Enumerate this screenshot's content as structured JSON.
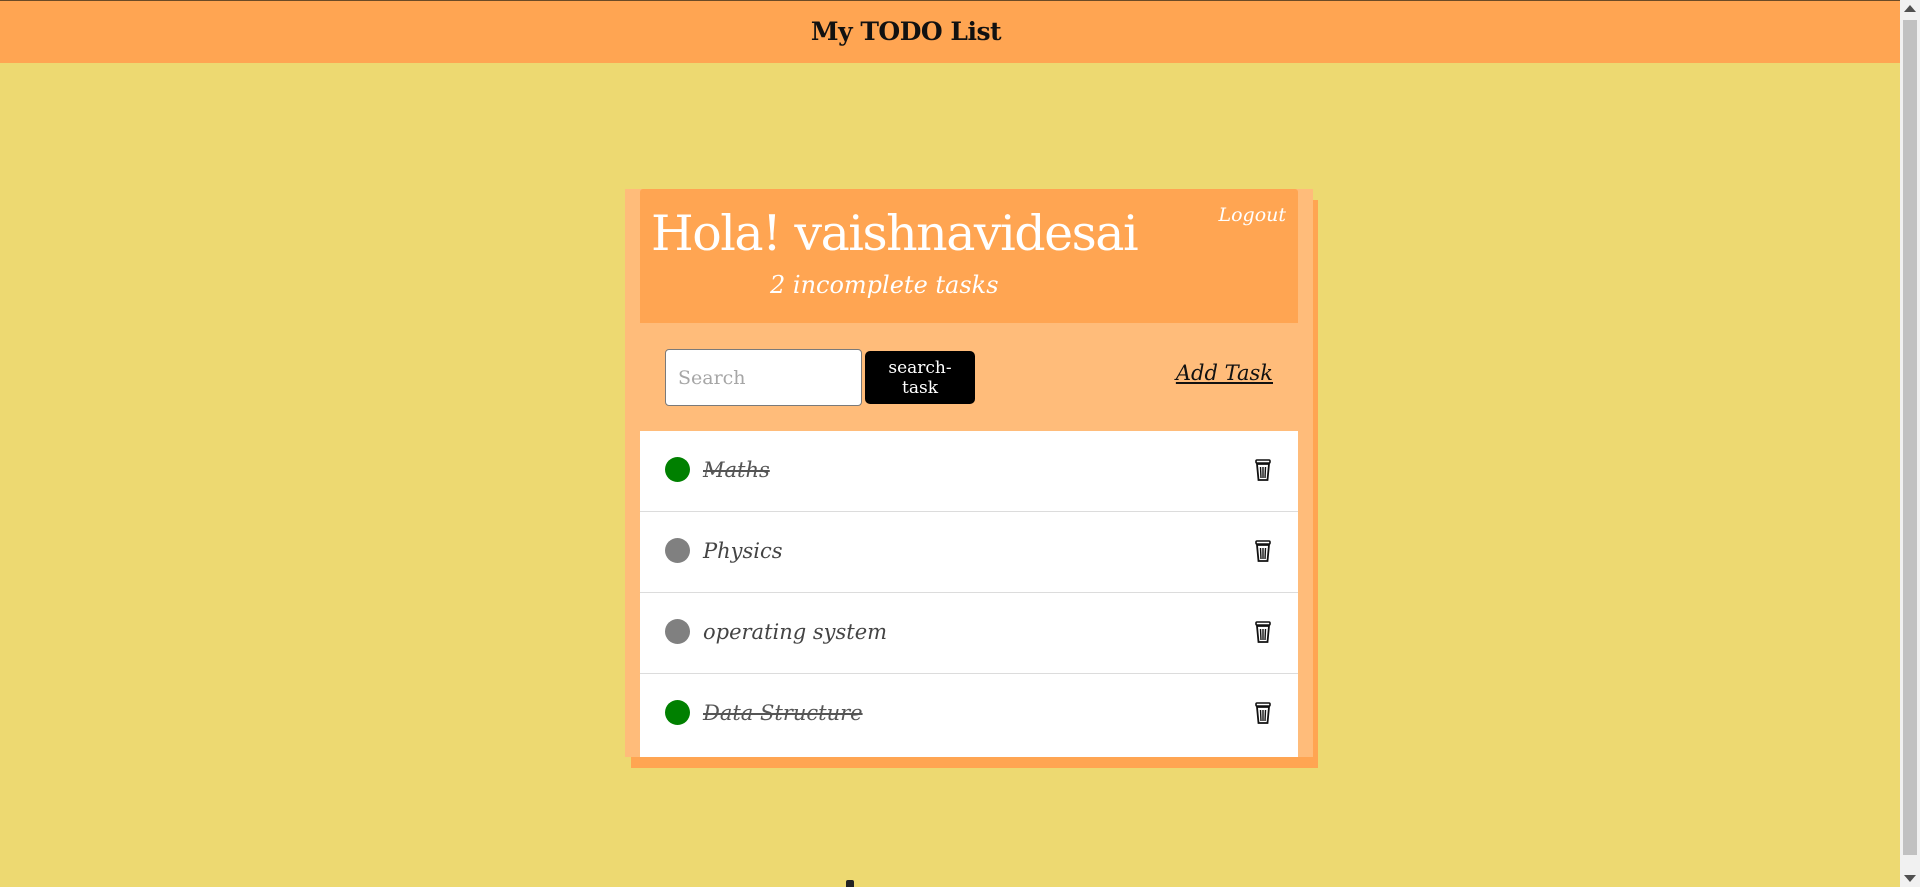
{
  "app": {
    "title": "My TODO List"
  },
  "header": {
    "greeting": "Hola! vaishnavidesai",
    "task_count": "2 incomplete tasks",
    "logout_label": "Logout"
  },
  "toolbar": {
    "search_placeholder": "Search",
    "search_value": "",
    "search_button_label": "search-task",
    "add_task_label": "Add Task"
  },
  "tasks": [
    {
      "label": "Maths",
      "completed": true
    },
    {
      "label": "Physics",
      "completed": false
    },
    {
      "label": "operating system",
      "completed": false
    },
    {
      "label": "Data Structure",
      "completed": true
    }
  ],
  "colors": {
    "background": "#edd971",
    "header": "#ffa552",
    "card": "#ffbc7a",
    "completed": "#008000",
    "pending": "#808080"
  },
  "icons": {
    "delete": "trash-icon"
  }
}
